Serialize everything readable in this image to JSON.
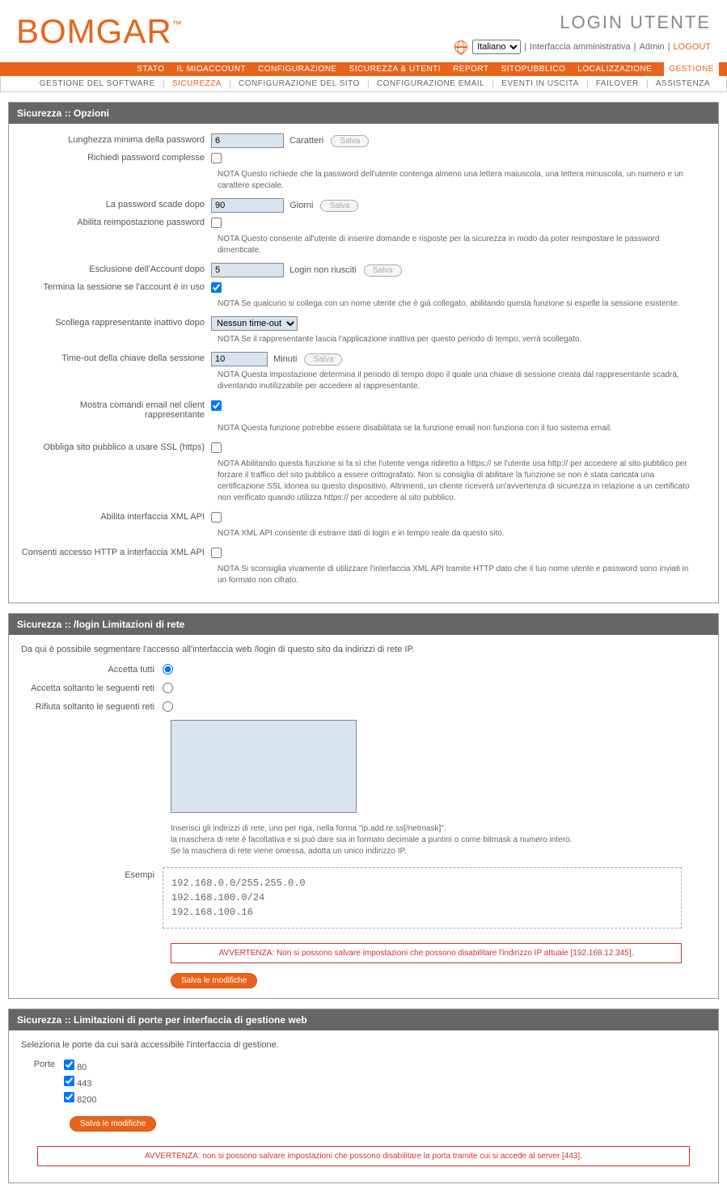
{
  "header": {
    "logo": "BOMGAR",
    "title": "LOGIN UTENTE",
    "language_selected": "Italiano",
    "link_admin_interface": "Interfaccia amministrativa",
    "link_admin": "Admin",
    "link_logout": "LOGOUT"
  },
  "nav_primary": [
    {
      "label": "STATO",
      "active": false
    },
    {
      "label": "IL MIOACCOUNT",
      "active": false
    },
    {
      "label": "CONFIGURAZIONE",
      "active": false
    },
    {
      "label": "SICUREZZA & UTENTI",
      "active": false
    },
    {
      "label": "REPORT",
      "active": false
    },
    {
      "label": "SITOPUBBLICO",
      "active": false
    },
    {
      "label": "LOCALIZZAZIONE",
      "active": false
    },
    {
      "label": "GESTIONE",
      "active": true
    }
  ],
  "nav_secondary": [
    {
      "label": "GESTIONE DEL SOFTWARE",
      "active": false
    },
    {
      "label": "SICUREZZA",
      "active": true
    },
    {
      "label": "CONFIGURAZIONE DEL SITO",
      "active": false
    },
    {
      "label": "CONFIGURAZIONE EMAIL",
      "active": false
    },
    {
      "label": "EVENTI IN USCITA",
      "active": false
    },
    {
      "label": "FAILOVER",
      "active": false
    },
    {
      "label": "ASSISTENZA",
      "active": false
    }
  ],
  "section1": {
    "title": "Sicurezza :: Opzioni",
    "rows": {
      "min_pw_len": {
        "label": "Lunghezza minima della password",
        "value": "6",
        "suffix": "Caratteri",
        "btn": "Salva"
      },
      "complex_pw": {
        "label": "Richiedi password complesse"
      },
      "complex_pw_note": "NOTA Questo richiede che la password dell'utente contenga almeno una lettera maiuscola, una lettera minuscola, un numero e un carattere speciale.",
      "pw_expire": {
        "label": "La password scade dopo",
        "value": "90",
        "suffix": "Giorni",
        "btn": "Salva"
      },
      "pw_reset": {
        "label": "Abilita reimpostazione password"
      },
      "pw_reset_note": "NOTA Questo consente all'utente di inserire domande e risposte per la sicurezza in modo da poter reimpostare le password dimenticate.",
      "lockout": {
        "label": "Esclusione dell'Account dopo",
        "value": "5",
        "suffix": "Login non riusciti",
        "btn": "Salva"
      },
      "terminate": {
        "label": "Termina la sessione se l'account è in uso",
        "checked": true
      },
      "terminate_note": "NOTA Se qualcuno si collega con un nome utente che è già collegato, abilitando questa funzione si espelle la sessione esistente.",
      "idle": {
        "label": "Scollega rappresentante inattivo dopo",
        "value": "Nessun time-out"
      },
      "idle_note": "NOTA Se il rappresentante lascia l'applicazione inattiva per questo periodo di tempo, verrà scollegato.",
      "key_timeout": {
        "label": "Time-out della chiave della sessione",
        "value": "10",
        "suffix": "Minuti",
        "btn": "Salva"
      },
      "key_timeout_note": "NOTA Questa impostazione determina il periodo di tempo dopo il quale una chiave di sessione creata dal rappresentante scadrà, diventando inutilizzabile per accedere al rappresentante.",
      "show_email": {
        "label": "Mostra comandi email nel client rappresentante",
        "checked": true
      },
      "show_email_note": "NOTA Questa funzione potrebbe essere disabilitata se la funzione email non funziona con il tuo sistema email.",
      "force_ssl": {
        "label": "Obbliga sito pubblico a usare SSL (https)"
      },
      "force_ssl_note": "NOTA Abilitando questa funzione si fa sì che l'utente venga ridiretto a https:// se l'utente usa http:// per accedere al sito pubblico per forzare il traffico del sito pubblico a essere crittografato. Non si consiglia di abilitare la funzione se non è stata caricata una certificazione SSL idonea su questo dispositivo. Altrimenti, un cliente riceverà un'avvertenza di sicurezza in relazione a un certificato non verificato quando utilizza https:// per accedere al sito pubblico.",
      "xml_api": {
        "label": "Abilita interfaccia XML API"
      },
      "xml_api_note": "NOTA XML API consente di estrarre dati di login e in tempo reale da questo sito.",
      "xml_http": {
        "label": "Consenti accesso HTTP a interfaccia XML API"
      },
      "xml_http_note": "NOTA Si sconsiglia vivamente di utilizzare l'interfaccia XML API tramite HTTP dato che il tuo nome utente e password sono inviati in un formato non cifrato."
    }
  },
  "section2": {
    "title": "Sicurezza :: /login Limitazioni di rete",
    "intro": "Da qui è possibile segmentare l'accesso all'interfaccia web /login di questo sito da indirizzi di rete IP.",
    "radio_all": "Accetta tutti",
    "radio_accept": "Accetta soltanto le seguenti reti",
    "radio_reject": "Rifiuta soltanto le seguenti reti",
    "hint1": "Inserisci gli indirizzi di rete, uno per riga, nella forma \"ip.add.re.ss[/netmask]\".",
    "hint2": "la maschera di rete è facoltativa e si può dare sia in formato decimale a puntini o come bitmask a numero intero.",
    "hint3": "Se la maschera di rete viene omessa, adotta un unico indirizzo IP.",
    "examples_label": "Esempi",
    "example1": "192.168.0.0/255.255.0.0",
    "example2": "192.168.100.0/24",
    "example3": "192.168.100.16",
    "warning": "AVVERTENZA: Non si possono salvare impostazioni che possono disabilitare l'indirizzo IP attuale [192.168.12.345].",
    "save_btn": "Salva le modifiche"
  },
  "section3": {
    "title": "Sicurezza :: Limitazioni di porte per interfaccia di gestione web",
    "intro": "Seleziona le porte da cui sarà accessibile l'interfaccia di gestione.",
    "ports_label": "Porte",
    "ports": [
      {
        "label": "80",
        "checked": true
      },
      {
        "label": "443",
        "checked": true
      },
      {
        "label": "8200",
        "checked": true
      }
    ],
    "save_btn": "Salva le modifiche",
    "warning": "AVVERTENZA: non si possono salvare impostazioni che possono disabilitare la porta tramite cui si accede al server [443]."
  }
}
